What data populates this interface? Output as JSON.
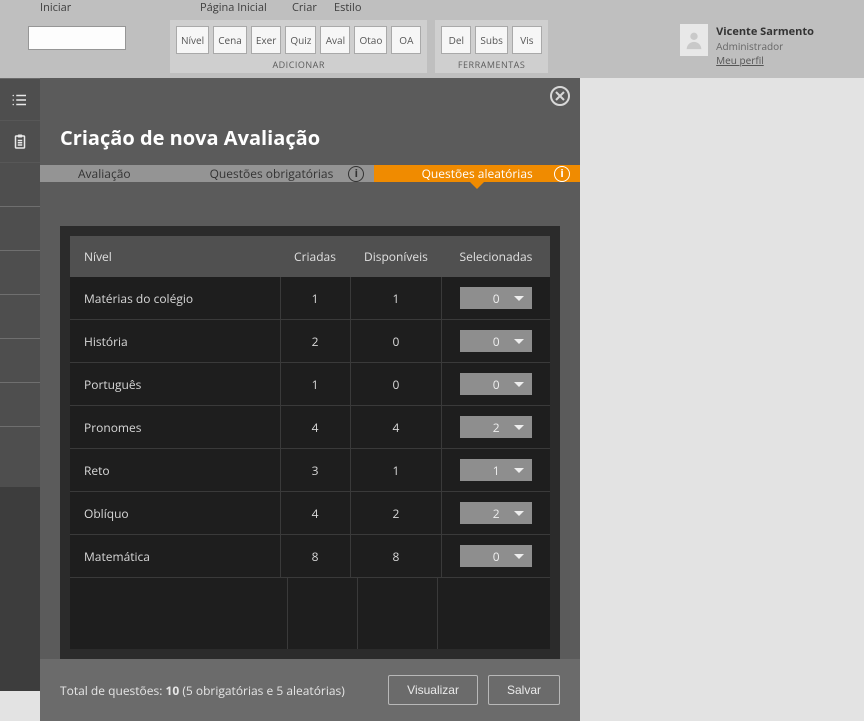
{
  "menubar": {
    "iniciar": "Iniciar",
    "pagina": "Página Inicial",
    "criar": "Criar",
    "estilo": "Estilo"
  },
  "ribbon": {
    "add_group_label": "ADICIONAR",
    "tools_group_label": "FERRAMENTAS",
    "add_buttons": [
      "Nível",
      "Cena",
      "Exer",
      "Quiz",
      "Aval",
      "Otao",
      "OA"
    ],
    "tool_buttons": [
      "Del",
      "Subs",
      "Vis"
    ]
  },
  "user": {
    "name": "Vicente Sarmento",
    "role": "Administrador",
    "profile_link": "Meu perfil"
  },
  "modal": {
    "title": "Criação de nova Avaliação",
    "tabs": {
      "t1": "Avaliação",
      "t2": "Questões obrigatórias",
      "t3": "Questões aleatórias",
      "info": "i"
    },
    "table": {
      "headers": {
        "level": "Nível",
        "created": "Criadas",
        "available": "Disponíveis",
        "selected": "Selecionadas"
      },
      "rows": [
        {
          "level": "Matérias do colégio",
          "created": "1",
          "available": "1",
          "selected": "0"
        },
        {
          "level": "História",
          "created": "2",
          "available": "0",
          "selected": "0"
        },
        {
          "level": "Português",
          "created": "1",
          "available": "0",
          "selected": "0"
        },
        {
          "level": "Pronomes",
          "created": "4",
          "available": "4",
          "selected": "2"
        },
        {
          "level": "Reto",
          "created": "3",
          "available": "1",
          "selected": "1"
        },
        {
          "level": "Oblíquo",
          "created": "4",
          "available": "2",
          "selected": "2"
        },
        {
          "level": "Matemática",
          "created": "8",
          "available": "8",
          "selected": "0"
        }
      ]
    },
    "footer": {
      "prefix": "Total de questões: ",
      "total": "10",
      "detail": " (5 obrigatórias e 5 aleatórias)",
      "preview": "Visualizar",
      "save": "Salvar"
    }
  }
}
